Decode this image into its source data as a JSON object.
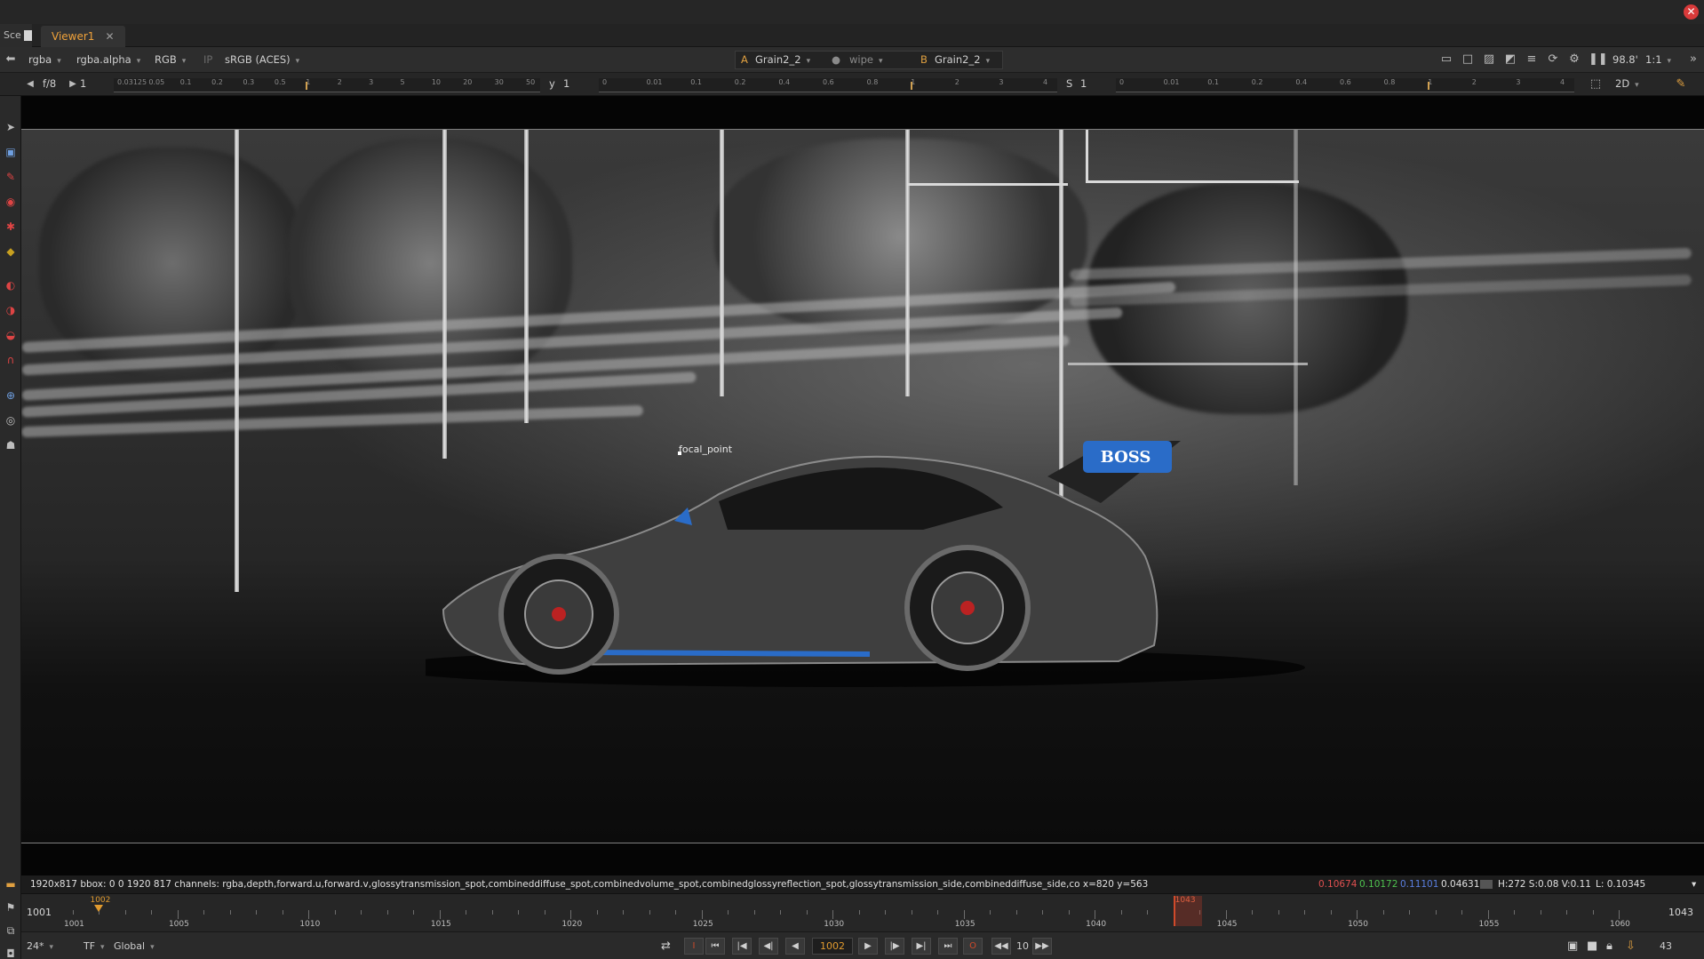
{
  "window": {
    "close_label": "✕"
  },
  "tabs": {
    "prev_label": "Sce",
    "active_label": "Viewer1",
    "close_label": "✕"
  },
  "toolbar": {
    "channels": "rgba",
    "alpha": "rgba.alpha",
    "rgb": "RGB",
    "ip": "IP",
    "colorspace": "sRGB (ACES)",
    "a_label": "A",
    "a_input": "Grain2_2",
    "wipe": "wipe",
    "b_label": "B",
    "b_input": "Grain2_2",
    "zoom": "98.8'",
    "ratio": "1:1",
    "view_mode": "2D"
  },
  "sliders": {
    "fstop": "f/8",
    "gain_value": "1",
    "gamma_label": "y",
    "gamma_value": "1",
    "sat_label": "S",
    "sat_value": "1",
    "gain_ticks": [
      "0.03125",
      "0.05",
      "0.1",
      "0.2",
      "0.3",
      "0.5",
      "1",
      "2",
      "3",
      "5",
      "10",
      "20",
      "30",
      "50"
    ],
    "gamma_ticks": [
      "0",
      "0.01",
      "0.1",
      "0.2",
      "0.4",
      "0.6",
      "0.8",
      "1",
      "2",
      "3",
      "4"
    ],
    "sat_ticks": [
      "0",
      "0.01",
      "0.1",
      "0.2",
      "0.4",
      "0.6",
      "0.8",
      "1",
      "2",
      "3",
      "4"
    ]
  },
  "viewer": {
    "focal_label": "focal_point",
    "logo_text": "BOSS"
  },
  "infobar": {
    "text": "1920x817  bbox: 0 0 1920 817 channels: rgba,depth,forward.u,forward.v,glossytransmission_spot,combineddiffuse_spot,combinedvolume_spot,combinedglossyreflection_spot,glossytransmission_side,combineddiffuse_side,co   x=820 y=563",
    "r": "0.10674",
    "g": "0.10172",
    "b": "0.11101",
    "a": "0.04631",
    "hsv": "H:272 S:0.08 V:0.11",
    "lum": "L: 0.10345",
    "colors": {
      "r": "#e05050",
      "g": "#4fc24f",
      "b": "#5a7fe0",
      "a": "#e0e0e0"
    }
  },
  "timeline": {
    "start": "1001",
    "end": "1043",
    "current_frame_marker": "1002",
    "out_marker": "1043",
    "labels": [
      "1001",
      "1005",
      "1010",
      "1015",
      "1020",
      "1025",
      "1030",
      "1035",
      "1040",
      "1045",
      "1050",
      "1055",
      "1060"
    ]
  },
  "controls": {
    "fps": "24*",
    "tf": "TF",
    "scope": "Global",
    "frame": "1002",
    "step": "10",
    "end_count": "43"
  }
}
